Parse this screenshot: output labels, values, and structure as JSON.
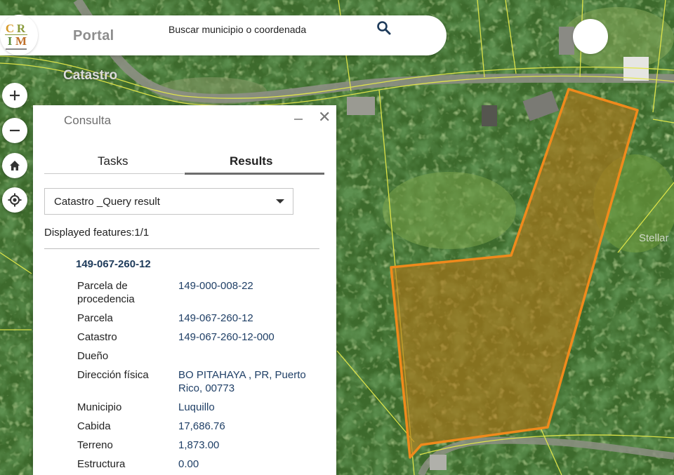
{
  "header": {
    "logo_letters": [
      "C",
      "R",
      "I",
      "M"
    ],
    "portal_label": "Portal",
    "search_placeholder": "Buscar municipio o coordenada",
    "search_icon": "search-icon"
  },
  "map": {
    "label": "Catastro",
    "label_right": "Stellar",
    "parcel_fill": "#b37618",
    "parcel_stroke": "#f08a1c",
    "boundary_color": "#e4e84a"
  },
  "map_controls": [
    {
      "name": "zoom-in-button",
      "icon": "plus-icon"
    },
    {
      "name": "zoom-out-button",
      "icon": "minus-icon"
    },
    {
      "name": "home-button",
      "icon": "home-icon"
    },
    {
      "name": "locate-button",
      "icon": "locate-icon"
    }
  ],
  "panel": {
    "title": "Consulta",
    "tabs": [
      "Tasks",
      "Results"
    ],
    "active_tab": "Results",
    "layer_select": "Catastro _Query result",
    "displayed_features": "Displayed features:1/1",
    "feature": {
      "id": "149-067-260-12",
      "attributes": [
        {
          "label": "Parcela de procedencia",
          "value": "149-000-008-22"
        },
        {
          "label": "Parcela",
          "value": "149-067-260-12"
        },
        {
          "label": "Catastro",
          "value": "149-067-260-12-000"
        },
        {
          "label": "Dueño",
          "value": ""
        },
        {
          "label": "Dirección física",
          "value": "BO PITAHAYA , PR, Puerto Rico, 00773"
        },
        {
          "label": "Municipio",
          "value": "Luquillo"
        },
        {
          "label": "Cabida",
          "value": "17,686.76"
        },
        {
          "label": "Terreno",
          "value": "1,873.00"
        },
        {
          "label": "Estructura",
          "value": "0.00"
        }
      ]
    }
  }
}
